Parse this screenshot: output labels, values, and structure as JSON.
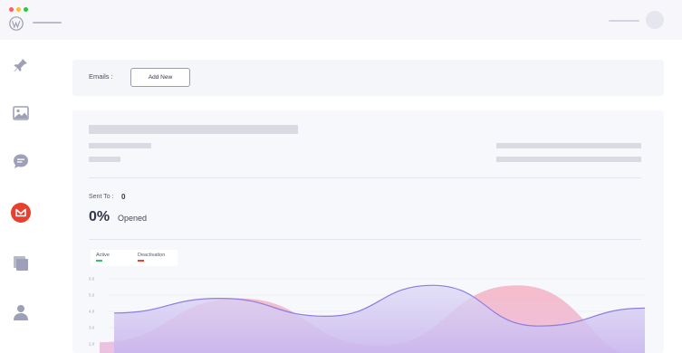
{
  "window": {
    "traffic_colors": [
      "#ff5f57",
      "#febc2e",
      "#28c840"
    ]
  },
  "sidebar": {
    "items": [
      {
        "icon": "pin-icon"
      },
      {
        "icon": "image-icon"
      },
      {
        "icon": "chat-icon"
      },
      {
        "icon": "mail-plugin-icon",
        "active": true,
        "color": "#e8402e"
      },
      {
        "icon": "pages-icon"
      },
      {
        "icon": "user-icon"
      }
    ]
  },
  "email_bar": {
    "label": "Emails :",
    "add_new": "Add New"
  },
  "stats": {
    "sent_to_label": "Sent To :",
    "sent_to_value": "0",
    "opened_percent": "0%",
    "opened_label": "Opened"
  },
  "legend": {
    "active": "Active",
    "active_color": "#3dbb6b",
    "deactivation": "Deactivation",
    "deactivation_color": "#e0443a"
  },
  "chart_data": {
    "type": "area",
    "y_ticks": [
      "6.0",
      "5.0",
      "4.0",
      "3.0",
      "2.0"
    ],
    "series": [
      {
        "values": [
          3.9,
          4.8,
          3.7,
          5.6,
          3.1,
          4.2
        ],
        "color": "#8f7de0"
      },
      {
        "values": [
          2.1,
          4.8,
          1.9,
          5.6,
          0.9
        ],
        "color": "#f3b9c6"
      }
    ],
    "grid": true,
    "legend_position": "top-left"
  }
}
